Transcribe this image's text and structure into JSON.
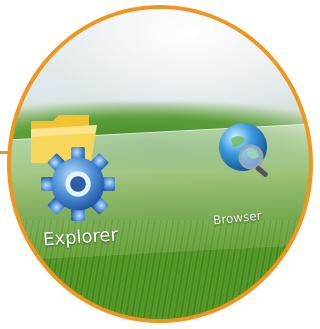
{
  "apps": [
    {
      "label": "Explorer",
      "icon": "gear-folder-icon"
    },
    {
      "label": "Browser",
      "icon": "globe-magnifier-icon"
    },
    {
      "label": "",
      "icon": "partial-app-icon"
    }
  ],
  "colors": {
    "frame": "#f0961e",
    "grass": "#4f8f26",
    "sky": "#eef3f6"
  }
}
